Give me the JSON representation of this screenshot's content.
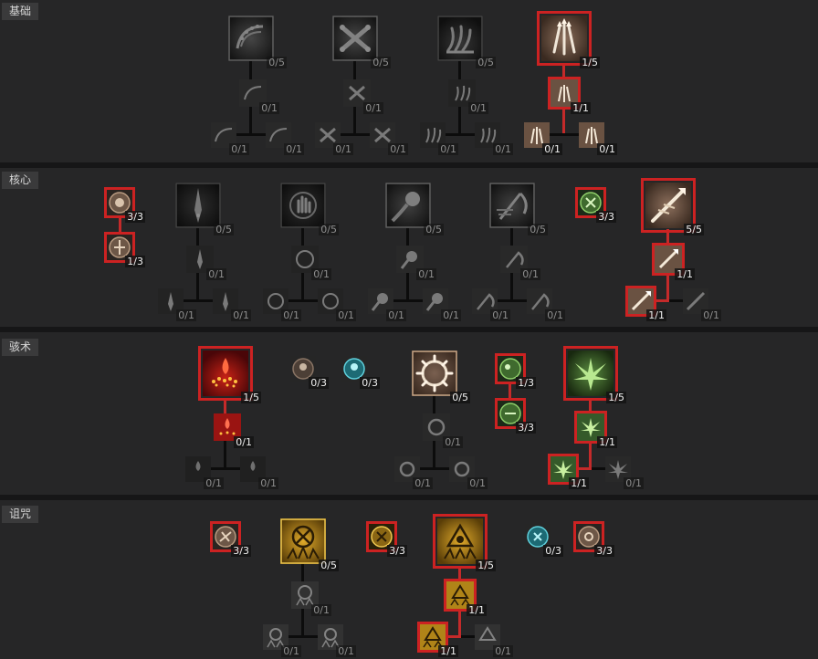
{
  "sections": {
    "basic": "基础",
    "core": "核心",
    "skill": "骇术",
    "curse": "诅咒"
  },
  "colors": {
    "learned_border": "#cc2222",
    "purple": "#5a3fa8",
    "red": "#a8161a",
    "bone": "#6a5242",
    "green": "#355a2a",
    "gold": "#b08418",
    "teal": "#1d6a74"
  },
  "skills": {
    "basic": {
      "hemorrhage": {
        "icon": "spine-wave-icon",
        "rank": "0/5",
        "upgrade": "0/1",
        "opt_a": "0/1",
        "opt_b": "0/1"
      },
      "reap": {
        "icon": "crossed-bones-icon",
        "rank": "0/5",
        "upgrade": "0/1",
        "opt_a": "0/1",
        "opt_b": "0/1"
      },
      "decompose": {
        "icon": "blood-claw-icon",
        "rank": "0/5",
        "upgrade": "0/1",
        "opt_a": "0/1",
        "opt_b": "0/1"
      },
      "bone_splinters": {
        "icon": "bone-spikes-icon",
        "rank": "1/5",
        "upgrade": "1/1",
        "opt_a": "0/1",
        "opt_b": "0/1"
      }
    },
    "core": {
      "passive_1": {
        "icon": "bone-disc-icon",
        "rank": "3/3"
      },
      "passive_2": {
        "icon": "bone-disc-icon",
        "rank": "1/3"
      },
      "blood_lance": {
        "icon": "blood-lance-icon",
        "rank": "0/5",
        "upgrade": "0/1",
        "opt_a": "0/1",
        "opt_b": "0/1"
      },
      "blood_surge": {
        "icon": "blood-hand-icon",
        "rank": "0/5",
        "upgrade": "0/1",
        "opt_a": "0/1",
        "opt_b": "0/1"
      },
      "blight": {
        "icon": "shadow-orb-icon",
        "rank": "0/5",
        "upgrade": "0/1",
        "opt_a": "0/1",
        "opt_b": "0/1"
      },
      "sever": {
        "icon": "scythe-icon",
        "rank": "0/5",
        "upgrade": "0/1",
        "opt_a": "0/1",
        "opt_b": "0/1"
      },
      "passive_3": {
        "icon": "green-rune-icon",
        "rank": "3/3"
      },
      "bone_spear": {
        "icon": "bone-spear-icon",
        "rank": "5/5",
        "upgrade": "1/1",
        "opt_a": "1/1",
        "opt_b": "0/1"
      }
    },
    "skill": {
      "corpse_explosion": {
        "icon": "blood-pool-icon",
        "rank": "1/5",
        "upgrade": "0/1",
        "opt_a": "0/1",
        "opt_b": "0/1"
      },
      "passive_1": {
        "icon": "bone-disc-icon",
        "rank": "0/3"
      },
      "passive_2": {
        "icon": "teal-rune-icon",
        "rank": "0/3"
      },
      "bone_prison": {
        "icon": "bone-ring-icon",
        "rank": "0/5",
        "upgrade": "0/1",
        "opt_a": "0/1",
        "opt_b": "0/1"
      },
      "passive_3": {
        "icon": "green-rune-icon",
        "rank": "1/3"
      },
      "passive_4": {
        "icon": "green-rune-icon",
        "rank": "3/3"
      },
      "corpse_tendrils": {
        "icon": "green-spikes-icon",
        "rank": "1/5",
        "upgrade": "1/1",
        "opt_a": "1/1",
        "opt_b": "0/1"
      }
    },
    "curse": {
      "passive_1": {
        "icon": "bone-disc-icon",
        "rank": "3/3"
      },
      "iron_maiden": {
        "icon": "gold-sigil-icon",
        "rank": "0/5",
        "upgrade": "0/1",
        "opt_a": "0/1",
        "opt_b": "0/1"
      },
      "passive_2": {
        "icon": "gold-rune-icon",
        "rank": "3/3"
      },
      "decrepify": {
        "icon": "gold-skull-icon",
        "rank": "1/5",
        "upgrade": "1/1",
        "opt_a": "1/1",
        "opt_b": "0/1"
      },
      "passive_3": {
        "icon": "teal-rune-icon",
        "rank": "0/3"
      },
      "passive_4": {
        "icon": "bone-disc-icon",
        "rank": "3/3"
      }
    }
  }
}
